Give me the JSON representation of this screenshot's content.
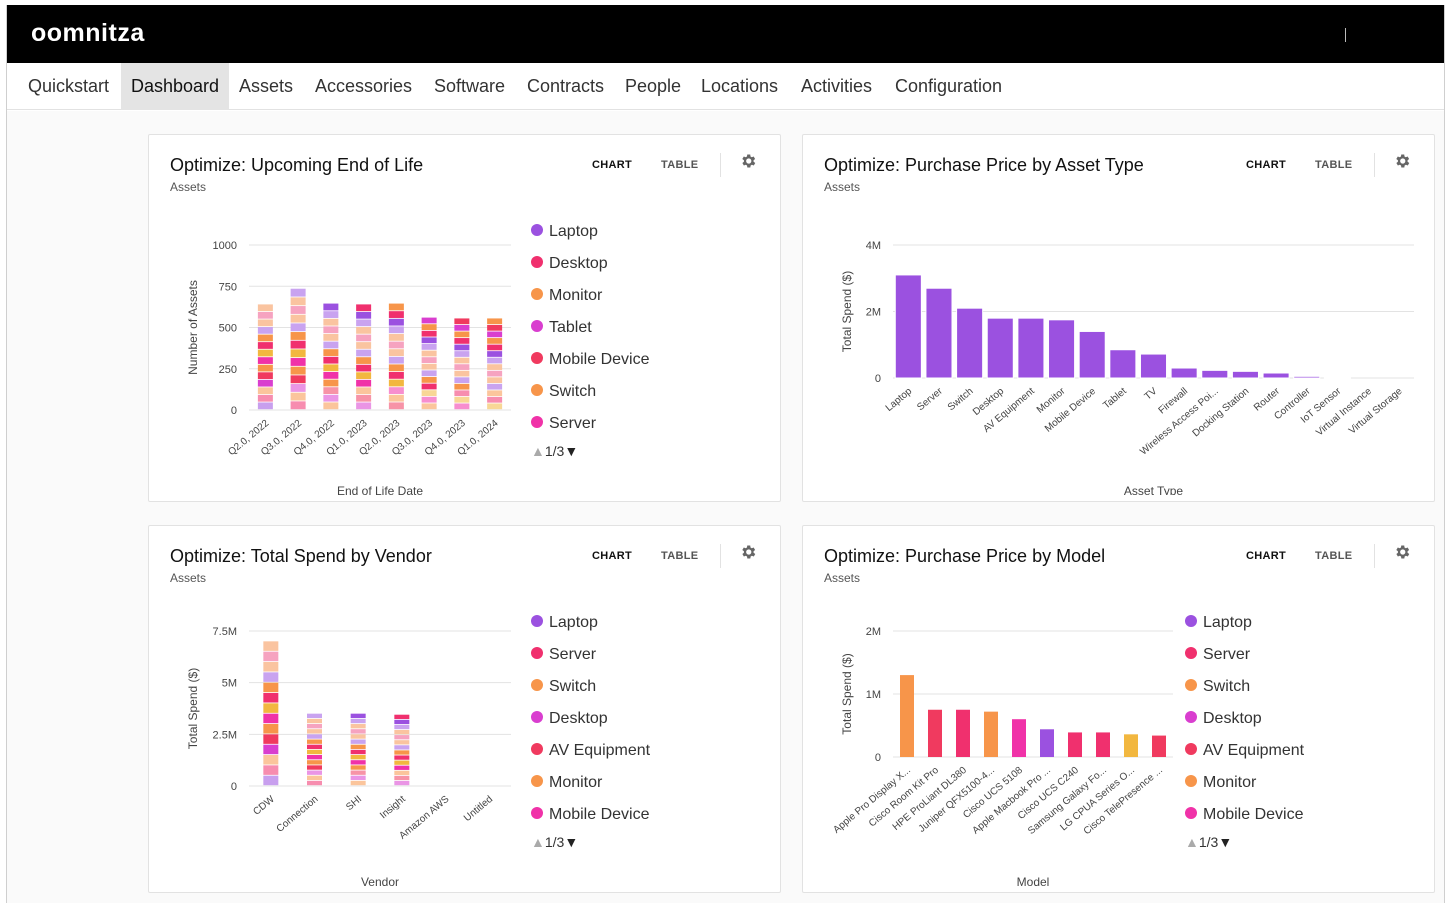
{
  "app": {
    "logo": "oomnitza"
  },
  "nav": [
    {
      "id": "quickstart",
      "label": "Quickstart",
      "active": false
    },
    {
      "id": "dashboard",
      "label": "Dashboard",
      "active": true
    },
    {
      "id": "assets",
      "label": "Assets",
      "active": false
    },
    {
      "id": "accessories",
      "label": "Accessories",
      "active": false
    },
    {
      "id": "software",
      "label": "Software",
      "active": false
    },
    {
      "id": "contracts",
      "label": "Contracts",
      "active": false
    },
    {
      "id": "people",
      "label": "People",
      "active": false
    },
    {
      "id": "locations",
      "label": "Locations",
      "active": false
    },
    {
      "id": "activities",
      "label": "Activities",
      "active": false
    },
    {
      "id": "configuration",
      "label": "Configuration",
      "active": false
    }
  ],
  "colors": {
    "purple": "#9b51e0",
    "pink": "#f0306e",
    "orange": "#f7954a",
    "magenta": "#d93ecf",
    "crimson": "#f03a5f",
    "hotpink": "#f032a8",
    "yellow": "#f2b73f",
    "lavender": "#c9a3f0",
    "peach": "#fac4a0",
    "rose": "#f6a3c0"
  },
  "widgets": {
    "eol": {
      "title": "Optimize: Upcoming End of Life",
      "subtitle": "Assets",
      "chart_label": "CHART",
      "table_label": "TABLE",
      "pager": "1/3",
      "legend": [
        {
          "label": "Laptop",
          "color": "#9b51e0"
        },
        {
          "label": "Desktop",
          "color": "#f0306e"
        },
        {
          "label": "Monitor",
          "color": "#f7954a"
        },
        {
          "label": "Tablet",
          "color": "#d93ecf"
        },
        {
          "label": "Mobile Device",
          "color": "#f03a5f"
        },
        {
          "label": "Switch",
          "color": "#f7954a"
        },
        {
          "label": "Server",
          "color": "#f032a8"
        }
      ]
    },
    "price_type": {
      "title": "Optimize: Purchase Price by Asset Type",
      "subtitle": "Assets",
      "chart_label": "CHART",
      "table_label": "TABLE"
    },
    "vendor": {
      "title": "Optimize: Total Spend by Vendor",
      "subtitle": "Assets",
      "chart_label": "CHART",
      "table_label": "TABLE",
      "pager": "1/3",
      "legend": [
        {
          "label": "Laptop",
          "color": "#9b51e0"
        },
        {
          "label": "Server",
          "color": "#f0306e"
        },
        {
          "label": "Switch",
          "color": "#f7954a"
        },
        {
          "label": "Desktop",
          "color": "#d93ecf"
        },
        {
          "label": "AV Equipment",
          "color": "#f03a5f"
        },
        {
          "label": "Monitor",
          "color": "#f7954a"
        },
        {
          "label": "Mobile Device",
          "color": "#f032a8"
        }
      ]
    },
    "model": {
      "title": "Optimize: Purchase Price by Model",
      "subtitle": "Assets",
      "chart_label": "CHART",
      "table_label": "TABLE",
      "pager": "1/3",
      "legend": [
        {
          "label": "Laptop",
          "color": "#9b51e0"
        },
        {
          "label": "Server",
          "color": "#f0306e"
        },
        {
          "label": "Switch",
          "color": "#f7954a"
        },
        {
          "label": "Desktop",
          "color": "#d93ecf"
        },
        {
          "label": "AV Equipment",
          "color": "#f03a5f"
        },
        {
          "label": "Monitor",
          "color": "#f7954a"
        },
        {
          "label": "Mobile Device",
          "color": "#f032a8"
        }
      ]
    }
  },
  "chart_data": [
    {
      "id": "eol",
      "type": "bar",
      "stacked": true,
      "xlabel": "End of Life Date",
      "ylabel": "Number of Assets",
      "ylim": [
        0,
        1000
      ],
      "yticks": [
        0,
        250,
        500,
        750,
        1000
      ],
      "ytick_labels": [
        "0",
        "250",
        "500",
        "750",
        "1000"
      ],
      "categories": [
        "Q2.0, 2022",
        "Q3.0, 2022",
        "Q4.0, 2022",
        "Q1.0, 2023",
        "Q2.0, 2023",
        "Q3.0, 2023",
        "Q4.0, 2023",
        "Q1.0, 2024"
      ],
      "values": [
        640,
        735,
        645,
        640,
        645,
        560,
        555,
        555
      ],
      "grid": true
    },
    {
      "id": "price_type",
      "type": "bar",
      "xlabel": "Asset Type",
      "ylabel": "Total Spend ($)",
      "ylim": [
        0,
        4000000
      ],
      "yticks": [
        0,
        2000000,
        4000000
      ],
      "ytick_labels": [
        "0",
        "2M",
        "4M"
      ],
      "categories": [
        "Laptop",
        "Server",
        "Switch",
        "Desktop",
        "AV Equipment",
        "Monitor",
        "Mobile Device",
        "Tablet",
        "TV",
        "Firewall",
        "Wireless Access Poi...",
        "Docking Station",
        "Router",
        "Controller",
        "IoT Sensor",
        "Virtual Instance",
        "Virtual Storage"
      ],
      "values": [
        3100000,
        2700000,
        2100000,
        1800000,
        1800000,
        1750000,
        1400000,
        850000,
        720000,
        300000,
        230000,
        200000,
        150000,
        50000,
        30000,
        0,
        0
      ],
      "color": "#9b51e0",
      "grid": true
    },
    {
      "id": "vendor",
      "type": "bar",
      "stacked": true,
      "xlabel": "Vendor",
      "ylabel": "Total Spend ($)",
      "ylim": [
        0,
        7500000
      ],
      "yticks": [
        0,
        2500000,
        5000000,
        7500000
      ],
      "ytick_labels": [
        "0",
        "2.5M",
        "5M",
        "7.5M"
      ],
      "categories": [
        "CDW",
        "Connection",
        "SHI",
        "Insight",
        "Amazon AWS",
        "Untitled"
      ],
      "values": [
        7000000,
        3500000,
        3500000,
        3450000,
        0,
        0
      ],
      "grid": true
    },
    {
      "id": "model",
      "type": "bar",
      "xlabel": "Model",
      "ylabel": "Total Spend ($)",
      "ylim": [
        0,
        2000000
      ],
      "yticks": [
        0,
        1000000,
        2000000
      ],
      "ytick_labels": [
        "0",
        "1M",
        "2M"
      ],
      "categories": [
        "Apple Pro Display X...",
        "Cisco Room Kit Pro",
        "HPE ProLiant DL380",
        "Juniper QFX5100-4...",
        "Cisco UCS 5108",
        "Apple Macbook Pro ...",
        "Cisco UCS C240",
        "Samsung Galaxy Fo...",
        "LG CPUA Series O...",
        "Cisco TelePresence ..."
      ],
      "values": [
        1300000,
        750000,
        750000,
        720000,
        600000,
        440000,
        390000,
        390000,
        360000,
        340000
      ],
      "colors": [
        "#f7954a",
        "#f03a5f",
        "#f0306e",
        "#f7954a",
        "#f032a8",
        "#9b51e0",
        "#f0306e",
        "#f0306e",
        "#f2b73f",
        "#f03a5f"
      ],
      "grid": true
    }
  ]
}
